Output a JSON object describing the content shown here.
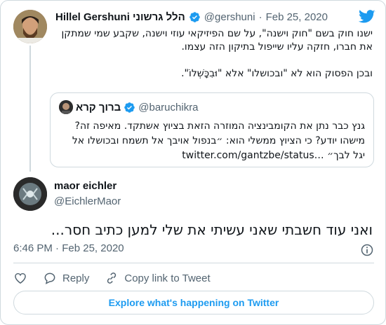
{
  "parent_tweet": {
    "author_name": "Hillel Gershuni הלל גרשוני",
    "handle": "@gershuni",
    "separator": "·",
    "date": "Feb 25, 2020",
    "body_lines": [
      "ישנו חוק בשם \"חוק וישנה\", על שם הפיזיקאי עוזי וישנה, שקבע שמי שמתקן את חברו, חזקה עליו שייפול בתיקון הזה עצמו.",
      "ובכן הפסוק הוא לא \"ובכושלו\" אלא \"וּבִכָּשְׁלוֹ\"."
    ]
  },
  "quoted_tweet": {
    "author_name": "ברוך קרא",
    "handle": "@baruchikra",
    "body": "גנץ כבר נתן את הקומבינציה המוזרה הזאת בציוץ אשתקד. מאיפה זה? מישהו יודע? כי הציוץ ממשלי הוא: ״בנפול אויבך אל תשמח ובכושלו אל יגל לבך״ …twitter.com/gantzbe/status"
  },
  "reply_tweet": {
    "author_name": "maor eichler",
    "handle": "@EichlerMaor",
    "body": "ואני עוד חשבתי שאני עשיתי את שלי למען כתיב חסר...",
    "time": "6:46 PM",
    "separator": "·",
    "date": "Feb 25, 2020"
  },
  "actions": {
    "reply_label": "Reply",
    "copy_link_label": "Copy link to Tweet"
  },
  "explore_label": "Explore what's happening on Twitter",
  "colors": {
    "brand": "#1d9bf0",
    "text": "#0f1419",
    "secondary": "#536471",
    "border": "#cfd9de"
  },
  "icons": {
    "logo": "twitter-bird-icon",
    "verified": "verified-badge-icon",
    "info": "info-icon",
    "like": "heart-icon",
    "reply": "speech-bubble-icon",
    "copy": "link-icon"
  }
}
